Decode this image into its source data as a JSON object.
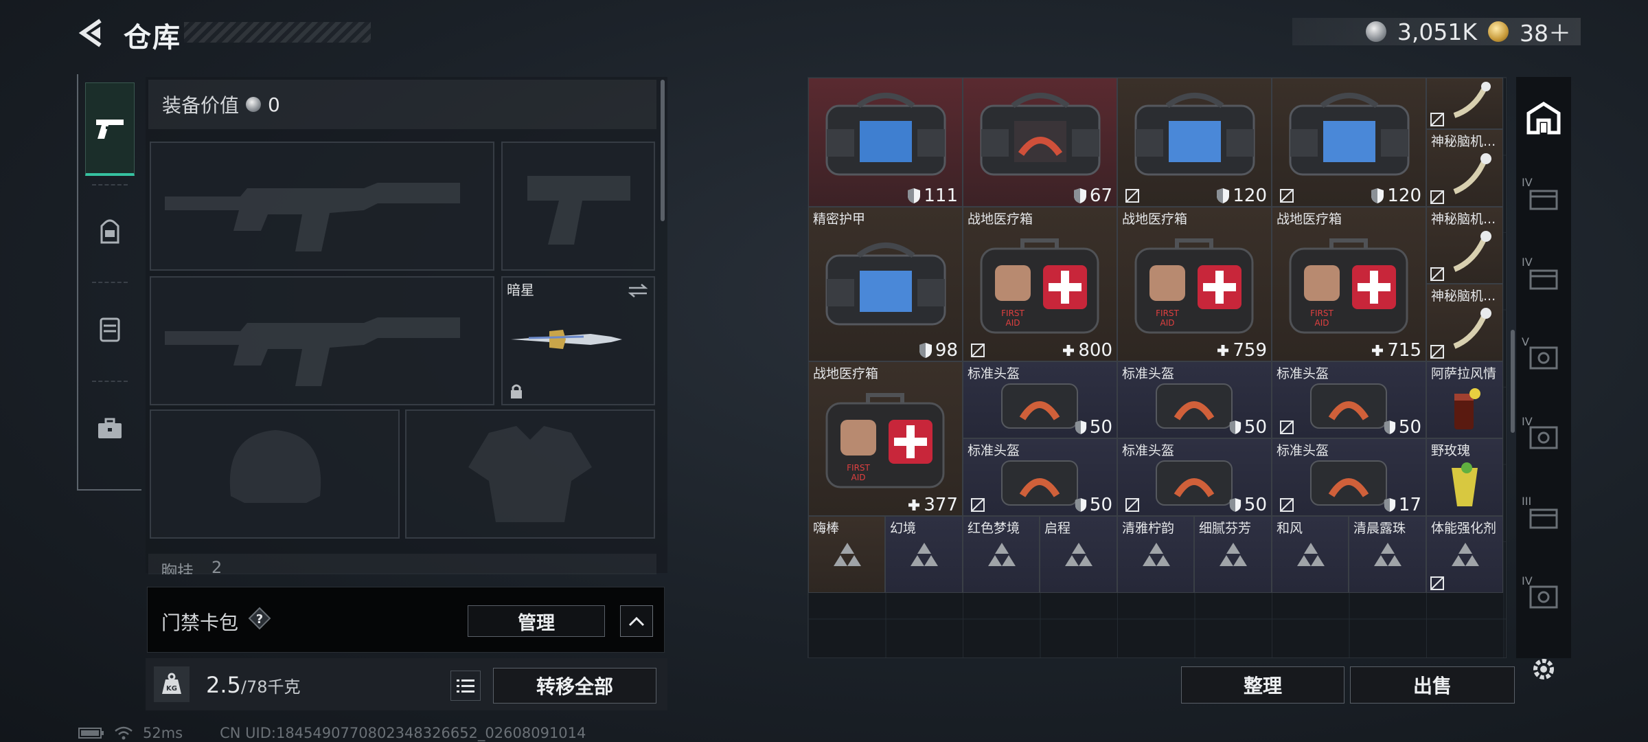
{
  "header": {
    "title": "仓库",
    "currency": {
      "silver": "3,051K",
      "gold": "38＋"
    }
  },
  "tabs": [
    {
      "id": "weapons",
      "icon": "pistol-icon",
      "active": true
    },
    {
      "id": "backpack",
      "icon": "backpack-icon",
      "active": false
    },
    {
      "id": "vest",
      "icon": "vest-icon",
      "active": false
    },
    {
      "id": "toolbox",
      "icon": "briefcase-icon",
      "active": false
    }
  ],
  "equipment": {
    "value_label": "装备价值",
    "value": "0",
    "melee_slot_name": "暗星",
    "chest_label": "胸挂",
    "chest_count": "2"
  },
  "keycard": {
    "label": "门禁卡包",
    "manage": "管理"
  },
  "weight": {
    "current": "2.5",
    "max": "/78千克",
    "transfer_all": "转移全部"
  },
  "status": {
    "ping": "52ms",
    "uid": "CN UID:1845490770802348326652_02608091014"
  },
  "warehouse": {
    "row1": [
      {
        "name": "",
        "value": "111",
        "type": "shield",
        "color": "red"
      },
      {
        "name": "",
        "value": "67",
        "type": "shield",
        "color": "red"
      },
      {
        "name": "",
        "value": "120",
        "type": "shield",
        "color": "brown",
        "noexport": true
      },
      {
        "name": "",
        "value": "120",
        "type": "shield",
        "color": "brown",
        "noexport": true
      },
      {
        "name": "",
        "value": "",
        "type": "",
        "color": "brown",
        "noexport": true
      }
    ],
    "row1_right_name": "神秘脑机...",
    "row2": [
      {
        "name": "精密护甲",
        "value": "98",
        "type": "shield",
        "color": "brown",
        "noexport": true
      },
      {
        "name": "战地医疗箱",
        "value": "800",
        "type": "plus",
        "color": "brown",
        "noexport": true
      },
      {
        "name": "战地医疗箱",
        "value": "759",
        "type": "plus",
        "color": "brown"
      },
      {
        "name": "战地医疗箱",
        "value": "715",
        "type": "plus",
        "color": "brown"
      }
    ],
    "row2_right": [
      "神秘脑机...",
      "神秘脑机..."
    ],
    "row3_medkit": {
      "name": "战地医疗箱",
      "value": "377"
    },
    "helmets": [
      {
        "name": "标准头盔",
        "value": "50",
        "noexport": false
      },
      {
        "name": "标准头盔",
        "value": "50",
        "noexport": false
      },
      {
        "name": "标准头盔",
        "value": "50",
        "noexport": true
      },
      {
        "name": "标准头盔",
        "value": "50",
        "noexport": true
      },
      {
        "name": "标准头盔",
        "value": "50",
        "noexport": true
      },
      {
        "name": "标准头盔",
        "value": "17",
        "noexport": true
      }
    ],
    "drinks": [
      {
        "name": "阿萨拉风情"
      },
      {
        "name": "野玫瑰"
      }
    ],
    "row5": [
      "嗨棒",
      "幻境",
      "红色梦境",
      "启程",
      "清雅柠韵",
      "细腻芬芳",
      "和风",
      "清晨露珠",
      "体能强化剂"
    ]
  },
  "actions": {
    "sort": "整理",
    "sell": "出售"
  },
  "colors": {
    "accent": "#36c2a0",
    "red_cell": "#5a2a30",
    "brown_cell": "#3a3029",
    "blue_cell": "#2e3042"
  }
}
